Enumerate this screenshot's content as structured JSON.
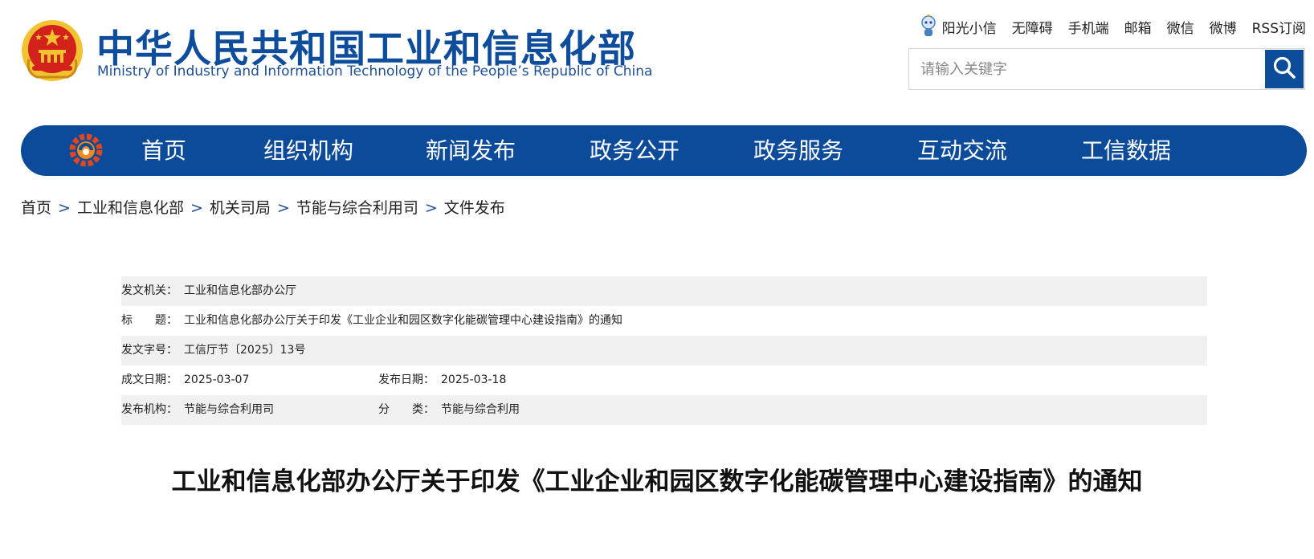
{
  "header": {
    "title_zh": "中华人民共和国工业和信息化部",
    "title_en": "Ministry of Industry and Information Technology of the People’s Republic of China",
    "emblem_icon": "national-emblem-icon",
    "top_links": [
      "阳光小信",
      "无障碍",
      "手机端",
      "邮箱",
      "微信",
      "微博",
      "RSS订阅"
    ],
    "search": {
      "placeholder": "请输入关键字",
      "icon": "search-icon"
    }
  },
  "nav": {
    "logo_icon": "gear-logo-icon",
    "items": [
      "首页",
      "组织机构",
      "新闻发布",
      "政务公开",
      "政务服务",
      "互动交流",
      "工信数据"
    ]
  },
  "breadcrumb": {
    "items": [
      "首页",
      "工业和信息化部",
      "机关司局",
      "节能与综合利用司",
      "文件发布"
    ],
    "separator": ">"
  },
  "meta": {
    "issuer_label": "发文机关：",
    "issuer": "工业和信息化部办公厅",
    "title_label": "标　　题：",
    "title": "工业和信息化部办公厅关于印发《工业企业和园区数字化能碳管理中心建设指南》的通知",
    "docno_label": "发文字号：",
    "docno": "工信厅节〔2025〕13号",
    "written_label": "成文日期：",
    "written": "2025-03-07",
    "published_label": "发布日期：",
    "published": "2025-03-18",
    "org_label": "发布机构：",
    "org": "节能与综合利用司",
    "category_label": "分　　类：",
    "category": "节能与综合利用"
  },
  "document": {
    "title": "工业和信息化部办公厅关于印发《工业企业和园区数字化能碳管理中心建设指南》的通知"
  },
  "colors": {
    "brand_blue": "#0c4b9a",
    "title_blue": "#0e4d9c",
    "row_shade": "#f0f0f0",
    "emblem_red": "#d3221c",
    "emblem_gold": "#f2c230"
  }
}
